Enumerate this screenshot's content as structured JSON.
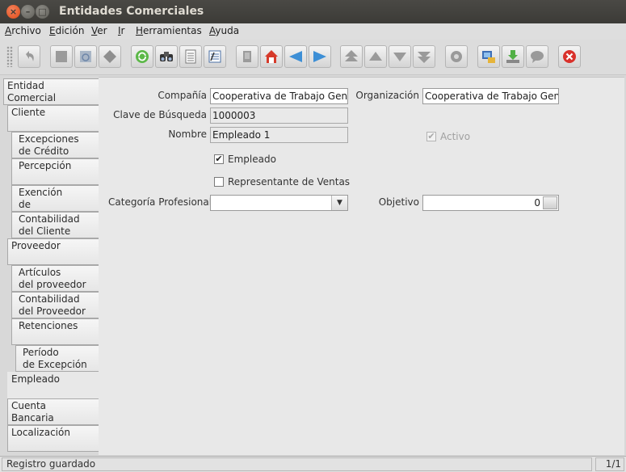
{
  "window": {
    "title": "Entidades Comerciales"
  },
  "menu": [
    "Archivo",
    "Edición",
    "Ver",
    "Ir",
    "Herramientas",
    "Ayuda"
  ],
  "toolbar_icons": [
    "undo-icon",
    "new-record-icon",
    "copy-record-icon",
    "delete-record-icon",
    "refresh-icon",
    "find-icon",
    "history-icon",
    "checklist-icon",
    "attachment-icon",
    "home-icon",
    "previous-icon",
    "next-icon",
    "first-record-icon",
    "previous-record-icon",
    "next-record-icon",
    "last-record-icon",
    "workflow-icon",
    "report-icon",
    "export-icon",
    "chat-icon",
    "exit-icon"
  ],
  "tabs": [
    "Entidad\nComercial",
    "Cliente",
    "Excepciones\nde Crédito",
    "Percepción",
    "Exención\nde Percepciones",
    "Contabilidad\ndel Cliente",
    "Proveedor",
    "Artículos\ndel proveedor",
    "Contabilidad\ndel Proveedor",
    "Retenciones",
    "Período\nde Excepción",
    "Empleado",
    "Cuenta\nBancaria",
    "Localización"
  ],
  "active_tab": "Empleado",
  "form": {
    "company_label": "Compañía",
    "company_value": "Cooperativa de Trabajo General",
    "org_label": "Organización",
    "org_value": "Cooperativa de Trabajo General",
    "search_key_label": "Clave de Búsqueda",
    "search_key_value": "1000003",
    "name_label": "Nombre",
    "name_value": "Empleado 1",
    "active_label": "Activo",
    "employee_label": "Empleado",
    "sales_rep_label": "Representante de Ventas",
    "category_label": "Categoría Profesional",
    "category_value": "",
    "objective_label": "Objetivo",
    "objective_value": "0"
  },
  "status": {
    "message": "Registro guardado",
    "count": "1/1"
  }
}
